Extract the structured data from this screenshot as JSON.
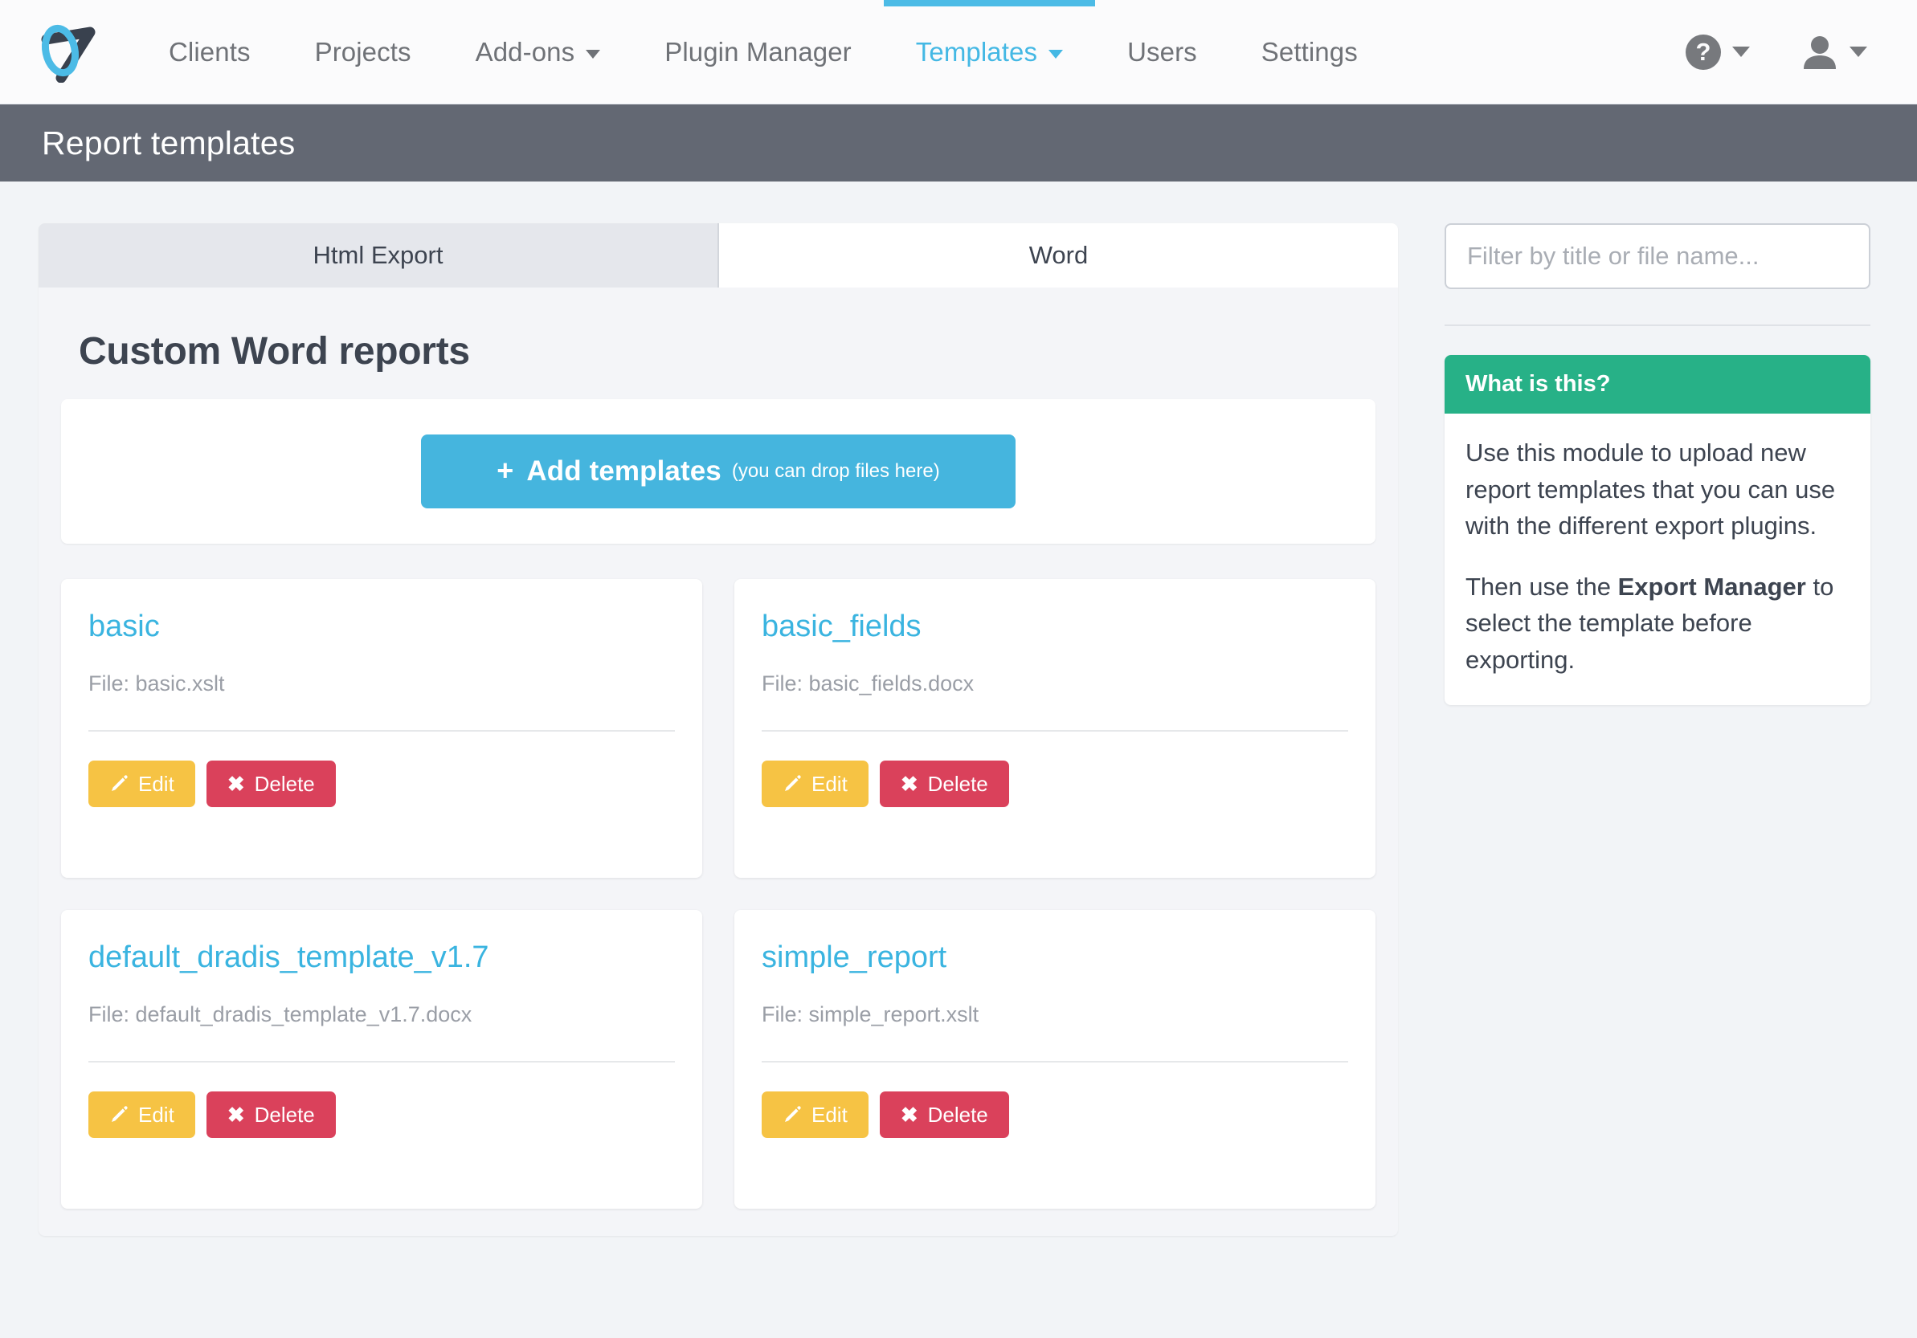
{
  "nav": {
    "logo_icon": "dradis-logo-icon",
    "items": [
      {
        "label": "Clients",
        "active": false,
        "has_caret": false
      },
      {
        "label": "Projects",
        "active": false,
        "has_caret": false
      },
      {
        "label": "Add-ons",
        "active": false,
        "has_caret": true
      },
      {
        "label": "Plugin Manager",
        "active": false,
        "has_caret": false
      },
      {
        "label": "Templates",
        "active": true,
        "has_caret": true
      },
      {
        "label": "Users",
        "active": false,
        "has_caret": false
      },
      {
        "label": "Settings",
        "active": false,
        "has_caret": false
      }
    ],
    "help_glyph": "?",
    "help_icon": "help-circle-icon",
    "account_icon": "user-avatar-icon",
    "accent_color": "#4cbbe6"
  },
  "page_header": {
    "title": "Report templates",
    "background": "#636873"
  },
  "tabs": [
    {
      "label": "Html Export",
      "active": false
    },
    {
      "label": "Word",
      "active": true
    }
  ],
  "main": {
    "section_title": "Custom Word reports",
    "add_button": {
      "plus": "+",
      "label": "Add templates",
      "hint": "(you can drop files here)",
      "color": "#45b5de"
    },
    "action_labels": {
      "edit": "Edit",
      "delete": "Delete",
      "delete_glyph": "✖"
    },
    "templates": [
      {
        "title": "basic",
        "file": "File: basic.xslt"
      },
      {
        "title": "basic_fields",
        "file": "File: basic_fields.docx"
      },
      {
        "title": "default_dradis_template_v1.7",
        "file": "File: default_dradis_template_v1.7.docx"
      },
      {
        "title": "simple_report",
        "file": "File: simple_report.xslt"
      }
    ]
  },
  "sidebar": {
    "filter_placeholder": "Filter by title or file name...",
    "filter_value": "",
    "help_panel": {
      "title": "What is this?",
      "header_color": "#27b187",
      "paragraph_1": "Use this module to upload new report templates that you can use with the different export plugins.",
      "paragraph_2_before": "Then use the ",
      "paragraph_2_bold": "Export Manager",
      "paragraph_2_after": " to select the template before exporting."
    }
  }
}
